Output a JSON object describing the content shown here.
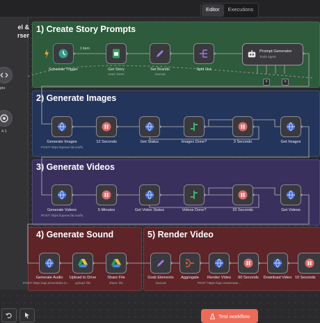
{
  "tabs": {
    "editor": "Editor",
    "executions": "Executions"
  },
  "left_panel": {
    "title_line1": "el &",
    "title_line2": "rser",
    "item1_label": "pts",
    "item2_label": "4.1"
  },
  "groups": {
    "story": {
      "title": "1) Create Story Prompts",
      "color": "#2d5b3b"
    },
    "images": {
      "title": "2) Generate Images",
      "color": "#24355c"
    },
    "videos": {
      "title": "3) Generate Videos",
      "color": "#3a305e"
    },
    "sound": {
      "title": "4) Generate Sound",
      "color": "#5e2428"
    },
    "render": {
      "title": "5) Render Video",
      "color": "#5e2428"
    }
  },
  "nodes": {
    "schedule": {
      "label": "Schedule Trigger"
    },
    "getstory": {
      "label": "Get Story",
      "sub": "read: sheet"
    },
    "setbrands": {
      "label": "Set Brands",
      "sub": "manual"
    },
    "splitout": {
      "label": "Split Out"
    },
    "promptgen": {
      "label": "Prompt Generator",
      "sub": "Tools Agent"
    },
    "genimages": {
      "label": "Generate Images",
      "sub": "POST: https://queue.fal.run/fal..."
    },
    "wait12": {
      "label": "12 Seconds"
    },
    "getstatus": {
      "label": "Get Status"
    },
    "imagesdone": {
      "label": "Images Done?"
    },
    "wait3": {
      "label": "3 Seconds"
    },
    "getimages": {
      "label": "Get Images"
    },
    "genvideos": {
      "label": "Generate Videos",
      "sub": "POST: https://queue.fal.run/fal..."
    },
    "wait5m": {
      "label": "5 Minutes"
    },
    "getvideostatus": {
      "label": "Get Video Status"
    },
    "videosdone": {
      "label": "Videos Done?"
    },
    "wait20": {
      "label": "20 Seconds"
    },
    "getvideos": {
      "label": "Get Videos"
    },
    "genaudio": {
      "label": "Generate Audio",
      "sub": "POST: https://api.elevenlabs.io..."
    },
    "uploaddrive": {
      "label": "Upload to Drive",
      "sub": "upload: file"
    },
    "sharefile": {
      "label": "Share File",
      "sub": "share: file"
    },
    "grabelements": {
      "label": "Grab Elements",
      "sub": "manual"
    },
    "aggregate": {
      "label": "Aggregate"
    },
    "rendervideo": {
      "label": "Render Video",
      "sub": "POST: https://api.creatomate..."
    },
    "wait60": {
      "label": "60 Seconds"
    },
    "downloadvideo": {
      "label": "Download Video"
    },
    "wait10": {
      "label": "10 Seconds"
    }
  },
  "edge_labels": {
    "one_item": "1 item"
  },
  "buttons": {
    "test_workflow": "Test workflow"
  },
  "colors": {
    "accent": "#ee6a58",
    "trigger": "#2f9d8a",
    "wait": "#e06a6a",
    "if_node": "#3fb26a",
    "edit": "#9f7be8",
    "sheets": "#2da65a"
  }
}
